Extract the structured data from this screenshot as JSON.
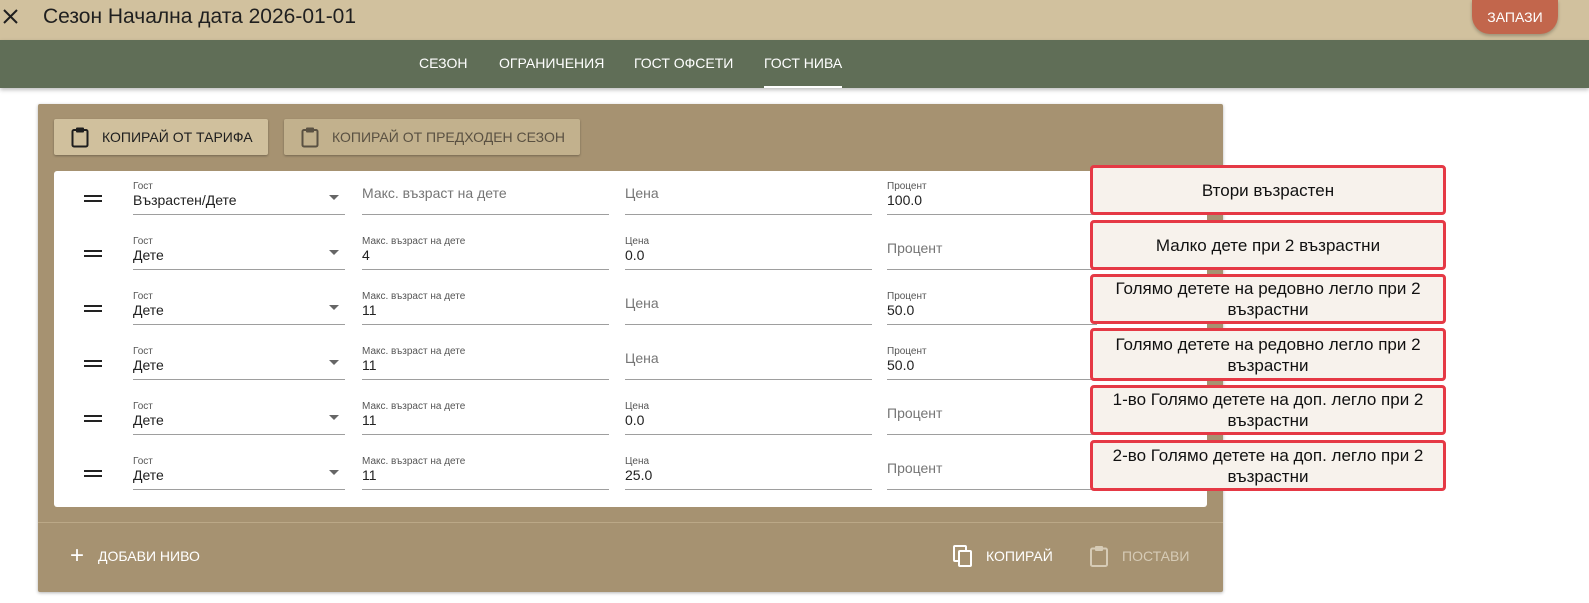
{
  "header": {
    "close_label": "×",
    "title": "Сезон Начална дата 2026-01-01",
    "save_label": "ЗАПАЗИ"
  },
  "tabs": [
    {
      "label": "СЕЗОН",
      "active": false
    },
    {
      "label": "ОГРАНИЧЕНИЯ",
      "active": false
    },
    {
      "label": "ГОСТ ОФСЕТИ",
      "active": false
    },
    {
      "label": "ГОСТ НИВА",
      "active": true
    }
  ],
  "copy_buttons": {
    "from_rate": "КОПИРАЙ ОТ ТАРИФА",
    "from_previous_season": "КОПИРАЙ ОТ ПРЕДХОДЕН СЕЗОН"
  },
  "labels": {
    "guest": "Гост",
    "max_child_age": "Макс. възраст на дете",
    "price": "Цена",
    "percent": "Процент"
  },
  "rows": [
    {
      "guest": "Възрастен/Дете",
      "max_age": "",
      "price": "",
      "percent": "100.0"
    },
    {
      "guest": "Дете",
      "max_age": "4",
      "price": "0.0",
      "percent": ""
    },
    {
      "guest": "Дете",
      "max_age": "11",
      "price": "",
      "percent": "50.0"
    },
    {
      "guest": "Дете",
      "max_age": "11",
      "price": "",
      "percent": "50.0"
    },
    {
      "guest": "Дете",
      "max_age": "11",
      "price": "0.0",
      "percent": ""
    },
    {
      "guest": "Дете",
      "max_age": "11",
      "price": "25.0",
      "percent": ""
    }
  ],
  "annotations": [
    "Втори възрастен",
    "Малко дете при 2 възрастни",
    "Голямо детете на редовно легло при 2 възрастни",
    "Голямо детете на редовно легло при 2 възрастни",
    "1-во Голямо детете на доп. легло при 2 възрастни",
    "2-во Голямо детете на доп. легло при 2 възрастни"
  ],
  "footer": {
    "add_level": "ДОБАВИ НИВО",
    "copy": "КОПИРАЙ",
    "paste": "ПОСТАВИ"
  },
  "colors": {
    "header_bg": "#d1c19e",
    "tabbar_bg": "#606e57",
    "card_bg": "#a69271",
    "save_button": "#c2664c",
    "annotation_border": "#e53945"
  },
  "icons": {
    "close": "close-icon",
    "clipboard": "clipboard-icon",
    "drag_handle": "drag-handle-icon",
    "dropdown": "chevron-down-icon",
    "add": "plus-icon",
    "copy": "copy-icon",
    "paste": "paste-icon"
  }
}
